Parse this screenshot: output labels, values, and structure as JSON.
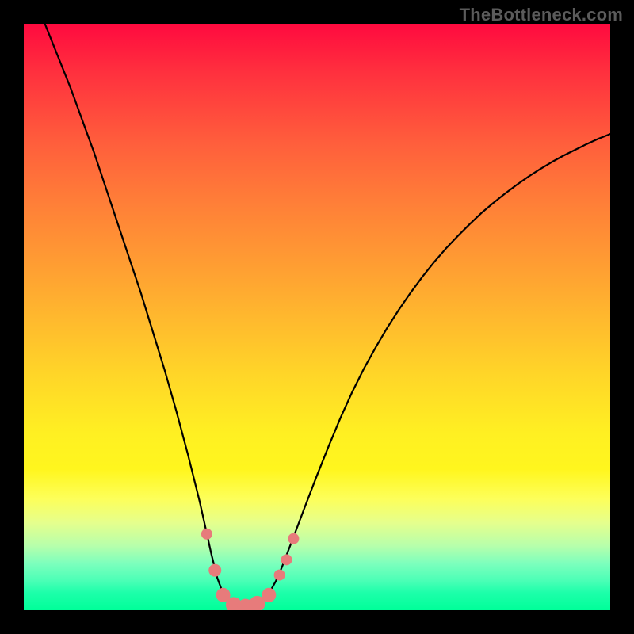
{
  "watermark": "TheBottleneck.com",
  "colors": {
    "curve_stroke": "#000000",
    "marker_fill": "#e77b7b",
    "marker_stroke": "#d46060"
  },
  "chart_data": {
    "type": "line",
    "title": "",
    "xlabel": "",
    "ylabel": "",
    "xlim": [
      0,
      100
    ],
    "ylim": [
      0,
      100
    ],
    "x": [
      0,
      2,
      4,
      6,
      8,
      10,
      12,
      14,
      16,
      18,
      20,
      22,
      24,
      26,
      28,
      30,
      31,
      32,
      33,
      34,
      35,
      36,
      37,
      38,
      39,
      40,
      41,
      42,
      43,
      44,
      46,
      48,
      50,
      52,
      54,
      56,
      58,
      60,
      62,
      64,
      66,
      68,
      70,
      72,
      74,
      76,
      78,
      80,
      82,
      84,
      86,
      88,
      90,
      92,
      94,
      96,
      98,
      100
    ],
    "y": [
      108,
      104,
      99,
      94,
      89,
      83.5,
      78,
      72,
      66,
      60,
      54,
      47.5,
      41,
      34,
      26.5,
      18.5,
      14,
      9.5,
      5.5,
      2.8,
      1.4,
      0.6,
      0.3,
      0.3,
      0.5,
      1,
      1.9,
      3.2,
      5,
      7.3,
      12.5,
      17.8,
      23,
      28,
      32.8,
      37.2,
      41.2,
      44.8,
      48.2,
      51.3,
      54.2,
      56.9,
      59.4,
      61.7,
      63.8,
      65.8,
      67.7,
      69.4,
      71,
      72.5,
      73.9,
      75.2,
      76.4,
      77.5,
      78.5,
      79.5,
      80.4,
      81.2
    ],
    "markers": [
      {
        "x": 31.2,
        "y": 13.0,
        "r": 7
      },
      {
        "x": 32.6,
        "y": 6.8,
        "r": 8
      },
      {
        "x": 34.0,
        "y": 2.6,
        "r": 9
      },
      {
        "x": 35.8,
        "y": 0.9,
        "r": 10
      },
      {
        "x": 37.8,
        "y": 0.6,
        "r": 10
      },
      {
        "x": 39.8,
        "y": 1.1,
        "r": 10
      },
      {
        "x": 41.8,
        "y": 2.6,
        "r": 9
      },
      {
        "x": 43.6,
        "y": 6.0,
        "r": 7
      },
      {
        "x": 44.8,
        "y": 8.6,
        "r": 7
      },
      {
        "x": 46.0,
        "y": 12.2,
        "r": 7
      }
    ]
  }
}
